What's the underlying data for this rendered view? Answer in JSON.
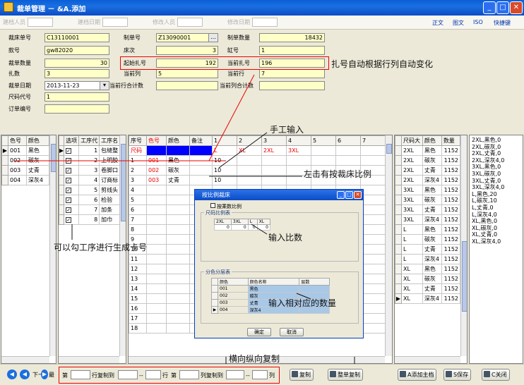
{
  "window": {
    "title": "裁单管理 － &A.添加"
  },
  "toolbar": {
    "filters": [
      {
        "label": "建档人员",
        "value": ""
      },
      {
        "label": "建档日期",
        "value": ""
      },
      {
        "label": "修改人员",
        "value": ""
      },
      {
        "label": "修改日期",
        "value": ""
      }
    ],
    "links": [
      "正文",
      "图文",
      "ISO",
      "快捷键"
    ]
  },
  "form": {
    "bed_no": {
      "label": "裁床单号",
      "value": "C13110001"
    },
    "style_no": {
      "label": "款号",
      "value": "gw82020"
    },
    "cut_qty": {
      "label": "裁单数量",
      "value": "30"
    },
    "bundles": {
      "label": "扎数",
      "value": "3"
    },
    "cut_date": {
      "label": "裁单日期",
      "value": "2013-11-23"
    },
    "size_code": {
      "label": "尺码代号",
      "value": "1"
    },
    "order_no": {
      "label": "订单编号",
      "value": ""
    },
    "doc_no": {
      "label": "制单号",
      "value": "Z13090001"
    },
    "bed_count": {
      "label": "床次",
      "value": "3"
    },
    "start_bundle": {
      "label": "起始扎号",
      "value": "192"
    },
    "cur_col": {
      "label": "当前列",
      "value": "5"
    },
    "cur_row_total": {
      "label": "当前行合计数",
      "value": ""
    },
    "doc_qty": {
      "label": "制单数量",
      "value": "18432"
    },
    "cylinder": {
      "label": "缸号",
      "value": "1"
    },
    "cur_bundle": {
      "label": "当前扎号",
      "value": "196"
    },
    "cur_row": {
      "label": "当前行",
      "value": "7"
    },
    "cur_col_total": {
      "label": "当前列合计数",
      "value": ""
    }
  },
  "annotations": {
    "bundle_auto": "扎号自动根据行列自动变化",
    "manual_input": "手工输入",
    "left_click": "左击有按裁床比例",
    "process_check": "可以勾工序进行生成卡号",
    "input_ratio": "输入比数",
    "input_qty": "输入相对应的数量",
    "copy": "横向纵向复制"
  },
  "color_grid": {
    "headers": [
      "色号",
      "颜色"
    ],
    "rows": [
      [
        "001",
        "黑色"
      ],
      [
        "002",
        "碳灰"
      ],
      [
        "003",
        "丈青"
      ],
      [
        "004",
        "深灰4"
      ]
    ]
  },
  "process_grid": {
    "headers": [
      "选项",
      "工序代",
      "工序名"
    ],
    "rows": [
      {
        "num": "1",
        "name": "包缝整"
      },
      {
        "num": "2",
        "name": "上明胶"
      },
      {
        "num": "3",
        "name": "卷脚口"
      },
      {
        "num": "4",
        "name": "订商标"
      },
      {
        "num": "5",
        "name": "剪线头"
      },
      {
        "num": "6",
        "name": "检验"
      },
      {
        "num": "7",
        "name": "加条"
      },
      {
        "num": "8",
        "name": "加巾"
      }
    ]
  },
  "main_grid": {
    "headers": [
      "序号",
      "色号",
      "颜色",
      "备注",
      "1",
      "2",
      "3",
      "4",
      "5",
      "6",
      "7"
    ],
    "size_row": {
      "label": "尺码",
      "sizes": [
        "L",
        "XL",
        "2XL",
        "3XL"
      ]
    },
    "rows": [
      {
        "seq": "1",
        "code": "001",
        "color": "黑色",
        "qty": "10"
      },
      {
        "seq": "2",
        "code": "002",
        "color": "碳灰",
        "qty": "10"
      },
      {
        "seq": "3",
        "code": "003",
        "color": "丈青",
        "qty": "10"
      }
    ],
    "row_numbers": [
      "4",
      "5",
      "6",
      "7",
      "8",
      "9",
      "10",
      "11",
      "12",
      "13",
      "14",
      "15",
      "16",
      "17",
      "18"
    ]
  },
  "summary_grid": {
    "headers": [
      "尺码大",
      "颜色",
      "数量"
    ],
    "rows": [
      [
        "2XL",
        "黑色",
        "1152"
      ],
      [
        "2XL",
        "碳灰",
        "1152"
      ],
      [
        "2XL",
        "丈青",
        "1152"
      ],
      [
        "2XL",
        "深灰4",
        "1152"
      ],
      [
        "3XL",
        "黑色",
        "1152"
      ],
      [
        "3XL",
        "碳灰",
        "1152"
      ],
      [
        "3XL",
        "丈青",
        "1152"
      ],
      [
        "3XL",
        "深灰4",
        "1152"
      ],
      [
        "L",
        "黑色",
        "1152"
      ],
      [
        "L",
        "碳灰",
        "1152"
      ],
      [
        "L",
        "丈青",
        "1152"
      ],
      [
        "L",
        "深灰4",
        "1152"
      ],
      [
        "XL",
        "黑色",
        "1152"
      ],
      [
        "XL",
        "碳灰",
        "1152"
      ],
      [
        "XL",
        "丈青",
        "1152"
      ],
      [
        "XL",
        "深灰4",
        "1152"
      ]
    ]
  },
  "notes_lines": [
    "2XL,黑色,0",
    "2XL,碳灰,0",
    "2XL,丈青,0",
    "2XL,深灰4,0",
    "3XL,黑色,0",
    "3XL,碳灰,0",
    "3XL,丈青,0",
    "3XL,深灰4,0",
    "L,黑色,20",
    "L,碳灰,10",
    "L,丈青,0",
    "L,深灰4,0",
    "XL,黑色,0",
    "XL,碳灰,0",
    "XL,丈青,0",
    "XL,深灰4,0"
  ],
  "dialog": {
    "title": "按比例裁床",
    "checkbox": "按乘数比例",
    "ratio_group": "尺码比例表",
    "ratio_headers": [
      "2XL",
      "3XL",
      "L",
      "XL"
    ],
    "ratio_values": [
      "0",
      "0",
      "0",
      "0"
    ],
    "color_group": "分色分层表",
    "color_headers": [
      "颜色",
      "颜色名称",
      "层数"
    ],
    "color_rows": [
      [
        "001",
        "黑色"
      ],
      [
        "002",
        "碳灰"
      ],
      [
        "003",
        "丈青"
      ],
      [
        "004",
        "深灰4"
      ]
    ],
    "ok": "确定",
    "cancel": "取消"
  },
  "bottom": {
    "next": "下一",
    "last": "最",
    "row_from": "第",
    "row_copy_to": "行复制到",
    "dash": "--",
    "row_end": "行",
    "col_from": "第",
    "col_copy_to": "列复制到",
    "col_end": "列",
    "copy": "复制",
    "whole_copy": "整单复制",
    "add_main": "A添加主档",
    "save": "S保存",
    "close": "C关闭"
  }
}
